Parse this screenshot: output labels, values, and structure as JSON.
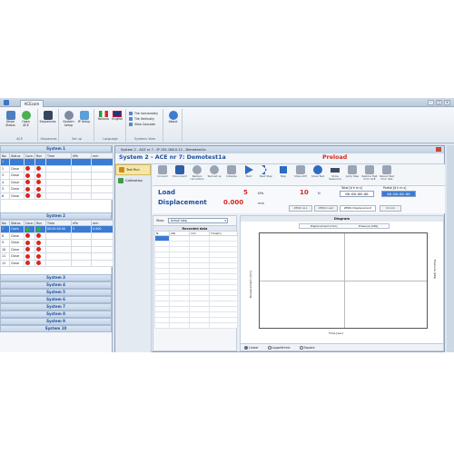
{
  "app": {
    "tab": "ACEcom"
  },
  "ribbon": {
    "groups": [
      {
        "label": "ACE",
        "buttons": [
          "Show Status",
          "Open ACE"
        ]
      },
      {
        "label": "Sequences",
        "buttons": [
          "Sequences"
        ]
      },
      {
        "label": "Set up",
        "buttons": [
          "System setup",
          "IP Setup"
        ]
      },
      {
        "label": "Language",
        "buttons": [
          "Italiano",
          "English"
        ]
      },
      {
        "label": "Systems View",
        "list": [
          "Tile horizontally",
          "Tile Vertically",
          "View Cascade"
        ]
      },
      {
        "label": "",
        "buttons": [
          "About"
        ]
      }
    ]
  },
  "left": {
    "columns": [
      "No.",
      "Status",
      "Conn.",
      "Run",
      "Time",
      "kPa",
      "mm"
    ],
    "system1": {
      "title": "System 1",
      "rows": [
        {
          "no": "1",
          "status": "",
          "conn": false,
          "run": false,
          "time": "",
          "kpa": "",
          "mm": "",
          "selected": true
        },
        {
          "no": "2",
          "status": "Close",
          "conn": false,
          "run": false
        },
        {
          "no": "3",
          "status": "Close",
          "conn": false,
          "run": false
        },
        {
          "no": "4",
          "status": "Close",
          "conn": false,
          "run": false
        },
        {
          "no": "5",
          "status": "Close",
          "conn": false,
          "run": false
        },
        {
          "no": "6",
          "status": "Close",
          "conn": false,
          "run": false
        }
      ]
    },
    "system2": {
      "title": "System 2",
      "rows": [
        {
          "no": "7",
          "status": "Open",
          "conn": true,
          "run": true,
          "time": "00:00:00:00",
          "kpa": "5",
          "mm": "0.000",
          "selected": true
        },
        {
          "no": "8",
          "status": "Close",
          "conn": false,
          "run": false
        },
        {
          "no": "9",
          "status": "Close",
          "conn": false,
          "run": false
        },
        {
          "no": "10",
          "status": "Close",
          "conn": false,
          "run": false
        },
        {
          "no": "11",
          "status": "Close",
          "conn": false,
          "run": false
        },
        {
          "no": "12",
          "status": "Close",
          "conn": false,
          "run": false
        }
      ]
    },
    "systems": [
      "System 3",
      "System 4",
      "System 5",
      "System 6",
      "System 7",
      "System 8",
      "System 9",
      "System 10"
    ]
  },
  "main": {
    "window_title": "System 2 - ACE nr 7 - IP 192.168.0.12 - Demotest1a",
    "header": "System 2 - ACE nr 7: Demotest1a",
    "phase": "Preload",
    "side_tabs": [
      "Test Run",
      "Calibration"
    ],
    "toolbar": [
      "Connect",
      "Disconnect",
      "Restore connection",
      "Test set up",
      "Initialize",
      "Start",
      "Next Step",
      "Stop",
      "Show ACE",
      "Show Test",
      "Show Sequence",
      "Jump Step",
      "Restore Test from ACE",
      "Reload Test from disk"
    ],
    "load_label": "Load",
    "load_value": "5",
    "load_unit": "kPa",
    "load_value2": "10",
    "load_unit2": "N",
    "disp_label": "Displacement",
    "disp_value": "0.000",
    "disp_unit": "mm",
    "total_label": "Total [d h m s]",
    "total_value": "00:00:00:00",
    "partial_label": "Partial [d h m s]",
    "partial_value": "00:00:00:00",
    "zero_buttons": [
      "ZERO ALL",
      "ZERO Load",
      "ZERO Displacement",
      "Unlock"
    ],
    "step_label": "Step:",
    "step_value": "Actual step",
    "recorded_title": "Recorded data",
    "rec_columns": [
      "N.",
      "kPa",
      "mm",
      "Time[h]"
    ],
    "diagram": {
      "title": "Diagram",
      "legend": [
        "Displacement [mm]",
        "Pressure [kPa]"
      ],
      "ylabel": "Displacement [mm]",
      "ylabel2": "Pressure [kPa]",
      "xlabel": "Time [sec]",
      "scales": [
        "Linear",
        "Logarithmic",
        "Square"
      ]
    }
  },
  "colors": {
    "accent": "#1e4f9c",
    "alert": "#d8281f",
    "ok": "#35b03a",
    "selection": "#3a7bd5"
  }
}
